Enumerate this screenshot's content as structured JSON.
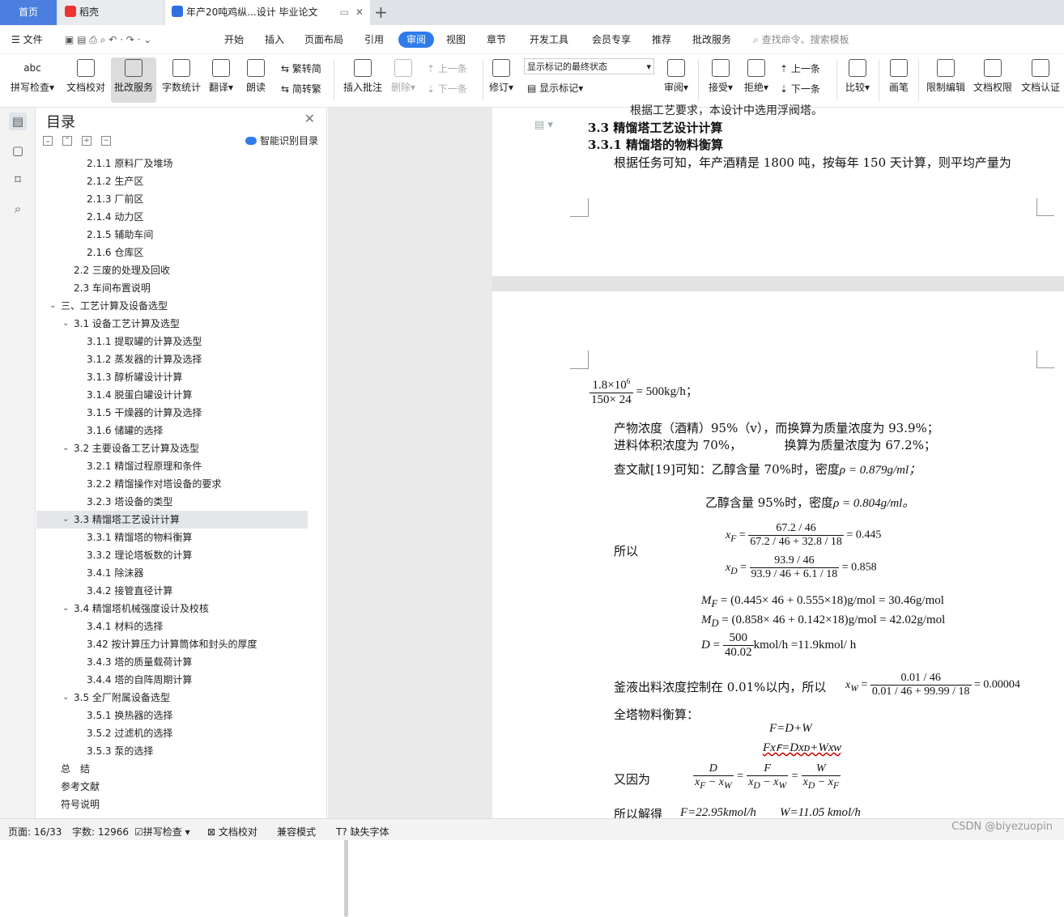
{
  "tabs": {
    "home": "首页",
    "daoke": "稻壳",
    "doc": "年产20吨鸡纵...设计 毕业论文"
  },
  "menu": {
    "file": "文件",
    "items": [
      "开始",
      "插入",
      "页面布局",
      "引用",
      "审阅",
      "视图",
      "章节",
      "开发工具",
      "会员专享",
      "推荐",
      "批改服务"
    ],
    "search": "查找命令、搜索模板"
  },
  "toolbar": {
    "spell": "拼写检查",
    "proof": "文档校对",
    "review_service": "批改服务",
    "wordcount": "字数统计",
    "translate": "翻译",
    "read": "朗读",
    "fan": "繁转简",
    "jian": "简转繁",
    "insert_comment": "插入批注",
    "delete": "删除",
    "prev_c": "上一条",
    "next_c": "下一条",
    "revise": "修订",
    "markup_state": "显示标记的最终状态",
    "show_markup": "显示标记",
    "review": "审阅",
    "accept": "接受",
    "reject": "拒绝",
    "prev": "上一条",
    "next": "下一条",
    "compare": "比较",
    "pen": "画笔",
    "restrict": "限制编辑",
    "permission": "文档权限",
    "certify": "文档认证"
  },
  "toc": {
    "title": "目录",
    "smart": "智能识别目录",
    "items": [
      {
        "t": "2.1.1 原料厂及堆场",
        "lv": 3
      },
      {
        "t": "2.1.2 生产区",
        "lv": 3
      },
      {
        "t": "2.1.3 厂前区",
        "lv": 3
      },
      {
        "t": "2.1.4 动力区",
        "lv": 3
      },
      {
        "t": "2.1.5 辅助车间",
        "lv": 3
      },
      {
        "t": "2.1.6 仓库区",
        "lv": 3
      },
      {
        "t": "2.2 三废的处理及回收",
        "lv": 2
      },
      {
        "t": "2.3 车间布置说明",
        "lv": 2
      },
      {
        "t": "三、工艺计算及设备选型",
        "lv": 1,
        "arrow": true
      },
      {
        "t": "3.1 设备工艺计算及选型",
        "lv": 2,
        "arrow": true
      },
      {
        "t": "3.1.1 提取罐的计算及选型",
        "lv": 3
      },
      {
        "t": "3.1.2 蒸发器的计算及选择",
        "lv": 3
      },
      {
        "t": "3.1.3 醇析罐设计计算",
        "lv": 3
      },
      {
        "t": "3.1.4 脱蛋白罐设计计算",
        "lv": 3
      },
      {
        "t": "3.1.5 干燥器的计算及选择",
        "lv": 3
      },
      {
        "t": "3.1.6 储罐的选择",
        "lv": 3
      },
      {
        "t": "3.2 主要设备工艺计算及选型",
        "lv": 2,
        "arrow": true
      },
      {
        "t": "3.2.1 精馏过程原理和条件",
        "lv": 3
      },
      {
        "t": "3.2.2 精馏操作对塔设备的要求",
        "lv": 3
      },
      {
        "t": "3.2.3 塔设备的类型",
        "lv": 3
      },
      {
        "t": "3.3 精馏塔工艺设计计算",
        "lv": 2,
        "arrow": true,
        "sel": true
      },
      {
        "t": "3.3.1 精馏塔的物料衡算",
        "lv": 3
      },
      {
        "t": "3.3.2 理论塔板数的计算",
        "lv": 3
      },
      {
        "t": "3.4.1 除沫器",
        "lv": 3
      },
      {
        "t": "3.4.2 接管直径计算",
        "lv": 3
      },
      {
        "t": "3.4 精馏塔机械强度设计及校核",
        "lv": 2,
        "arrow": true
      },
      {
        "t": "3.4.1 材料的选择",
        "lv": 3
      },
      {
        "t": "3.42 按计算压力计算筒体和封头的厚度",
        "lv": 3
      },
      {
        "t": "3.4.3 塔的质量载荷计算",
        "lv": 3
      },
      {
        "t": "3.4.4 塔的自阵周期计算",
        "lv": 3
      },
      {
        "t": "3.5 全厂附属设备选型",
        "lv": 2,
        "arrow": true
      },
      {
        "t": "3.5.1 换热器的选择",
        "lv": 3
      },
      {
        "t": "3.5.2 过滤机的选择",
        "lv": 3
      },
      {
        "t": "3.5.3 泵的选择",
        "lv": 3
      },
      {
        "t": "总　结",
        "lv": 0
      },
      {
        "t": "参考文献",
        "lv": 0
      },
      {
        "t": "符号说明",
        "lv": 0
      }
    ]
  },
  "doc": {
    "cut_line": "根据工艺要求，本设计中选用浮阀塔。",
    "h33": "3.3  精馏塔工艺设计计算",
    "h331": "3.3.1  精馏塔的物料衡算",
    "para1": "根据任务可知，年产酒精是 1800 吨，按每年 150 天计算，则平均产量为",
    "eq1_num": "1.8×10",
    "eq1_exp": "6",
    "eq1_den": "150× 24",
    "eq1_rhs": "= 500kg/h；",
    "p_prod": "产物浓度（酒精）95%（v），而换算为质量浓度为 93.9%；",
    "p_feed": "进料体积浓度为 70%，           换算为质量浓度为 67.2%；",
    "p_lit": "查文献[19]可知：乙醇含量 70%时，密度",
    "p_lit_v": "ρ = 0.879g/ml；",
    "p_95": "乙醇含量 95%时，密度",
    "p_95_v": "ρ = 0.804g/ml。",
    "so": "所以",
    "xf_num": "67.2 / 46",
    "xf_den": "67.2 / 46 + 32.8 / 18",
    "xf_val": "= 0.445",
    "xd_num": "93.9 / 46",
    "xd_den": "93.9 / 46 + 6.1 / 18",
    "xd_val": "= 0.858",
    "mf": "= (0.445× 46 + 0.555×18)g/mol = 30.46g/mol",
    "md": "= (0.858× 46 + 0.142×18)g/mol = 42.02g/mol",
    "d_num": "500",
    "d_den": "40.02",
    "d_rhs": "kmol/h =11.9kmol/ h",
    "p_kettle": "釜液出料浓度控制在 0.01%以内，所以",
    "xw_num": "0.01 / 46",
    "xw_den": "0.01 / 46 + 99.99 / 18",
    "xw_val": "= 0.00004",
    "p_total": "全塔物料衡算：",
    "eq_fdw": "F=D+W",
    "eq_fx": "Fxꜰ=Dxᴅ+Wxᴡ",
    "p_because": "又因为",
    "p_solve": "所以解得",
    "f_val": "F=22.95kmol/h",
    "w_val": "W=11.05 kmol/h"
  },
  "status": {
    "page": "页面: 16/33",
    "words": "字数: 12966",
    "spell": "拼写检查",
    "proof": "文档校对",
    "compat": "兼容模式",
    "font": "缺失字体"
  },
  "watermark": "CSDN @biyezuopin"
}
